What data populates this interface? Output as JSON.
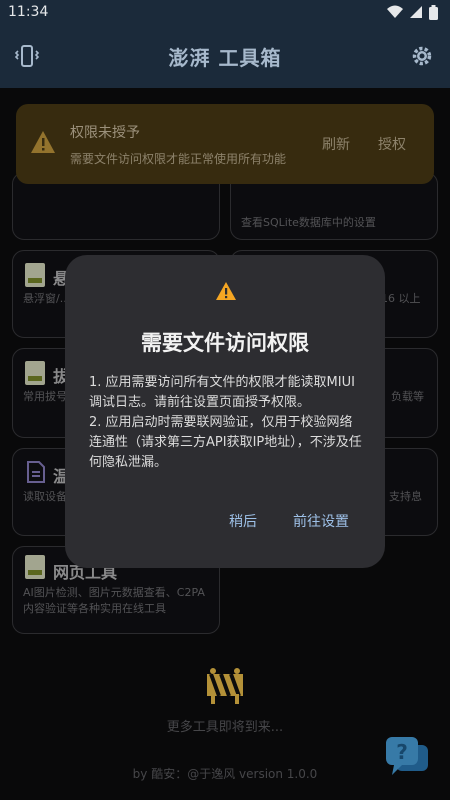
{
  "status_bar": {
    "time": "11:34"
  },
  "app_bar": {
    "title": "澎湃 工具箱"
  },
  "banner": {
    "title": "权限未授予",
    "description": "需要文件访问权限才能正常使用所有功能",
    "refresh_label": "刷新",
    "grant_label": "授权"
  },
  "cards": [
    {
      "title": "",
      "description": ""
    },
    {
      "title": "",
      "description": "查看SQLite数据库中的设置"
    },
    {
      "title": "悬",
      "description": "悬浮窗/..."
    },
    {
      "title": "",
      "description": "16 以上"
    },
    {
      "title": "拔",
      "description": "常用拔号..."
    },
    {
      "title": "",
      "description": "负载等"
    },
    {
      "title": "温",
      "description": "读取设备..."
    },
    {
      "title": "",
      "description": "支持息"
    },
    {
      "title": "网页工具",
      "description": "AI图片检测、图片元数据查看、C2PA内容验证等各种实用在线工具"
    }
  ],
  "dialog": {
    "title": "需要文件访问权限",
    "body_1": "1. 应用需要访问所有文件的权限才能读取MIUI调试日志。请前往设置页面授予权限。",
    "body_2": "2. 应用启动时需要联网验证，仅用于校验网络连通性（请求第三方API获取IP地址），不涉及任何隐私泄漏。",
    "later_label": "稍后",
    "settings_label": "前往设置"
  },
  "more_tools": "更多工具即将到来...",
  "footer": "by 酷安：@于逸风 version 1.0.0",
  "colors": {
    "accent": "#9ec1e8",
    "appbar": "#1b2a3a",
    "banner": "#4a3a14",
    "warning": "#f5a623"
  }
}
